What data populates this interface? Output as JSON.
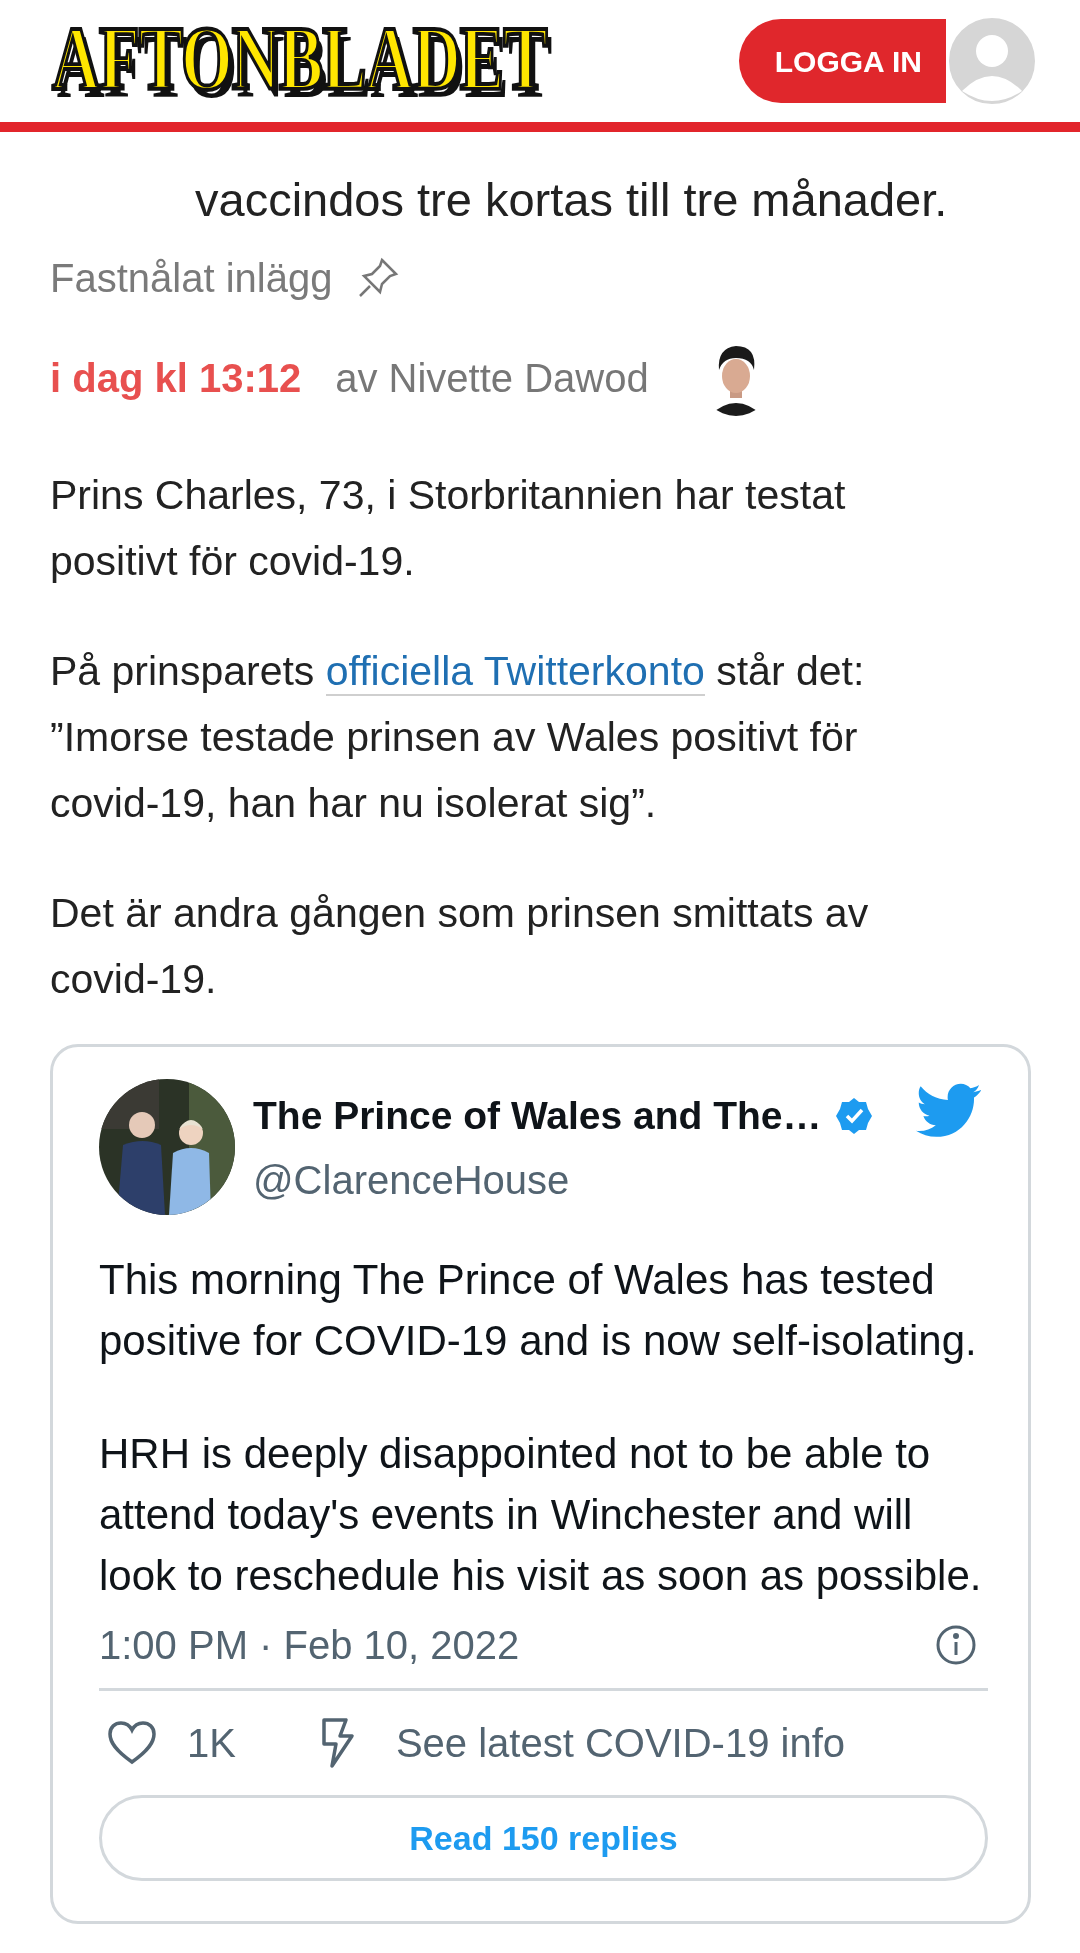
{
  "header": {
    "logo": "AFTONBLADET",
    "login_button": "LOGGA IN"
  },
  "article": {
    "intro_end": "vaccindos tre kortas till tre månader.",
    "pinned_label": "Fastnålat inlägg",
    "timestamp": "i dag kl 13:12",
    "byline": "av Nivette Dawod",
    "paragraphs": [
      {
        "before": "Prins Charles, 73, i Storbritannien har testat positivt för covid-19."
      },
      {
        "before": "På prinsparets ",
        "link": "officiella Twitterkonto",
        "after": " står det: ”Imorse testade prinsen av Wales positivt för covid-19, han har nu isolerat sig”."
      },
      {
        "before": "Det är andra gången som prinsen smittats av covid-19."
      }
    ]
  },
  "tweet": {
    "name": "The Prince of Wales and The…",
    "verified": true,
    "handle": "@ClarenceHouse",
    "text": [
      "This morning The Prince of Wales has tested positive for COVID-19 and is now self-isolating.",
      "HRH is deeply disappointed not to be able to attend today's events in Winchester and will look to reschedule his visit as soon as possible."
    ],
    "time": "1:00 PM · Feb 10, 2022",
    "likes": "1K",
    "info_link": "See latest COVID-19 info",
    "replies_button": "Read 150 replies"
  }
}
